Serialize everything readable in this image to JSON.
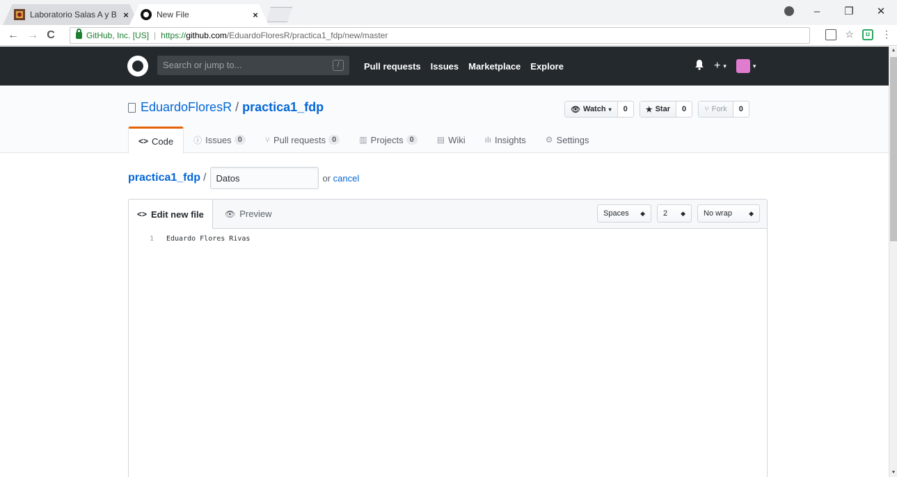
{
  "browser": {
    "tabs": [
      {
        "title": "Laboratorio Salas A y B",
        "close": "×"
      },
      {
        "title": "New File",
        "close": "×"
      }
    ],
    "window_controls": [
      "–",
      "❐",
      "✕"
    ],
    "nav": {
      "back": "←",
      "forward": "→",
      "reload": "C"
    },
    "address": {
      "secure_label": "GitHub, Inc. [US]",
      "url_proto": "https://",
      "url_host": "github.com",
      "url_path": "/EduardoFloresR/practica1_fdp/new/master"
    },
    "extensions": {
      "star": "☆",
      "pocket": "ʊ",
      "menu": "⋮"
    }
  },
  "gh_header": {
    "search_placeholder": "Search or jump to...",
    "search_key": "/",
    "nav": [
      "Pull requests",
      "Issues",
      "Marketplace",
      "Explore"
    ],
    "bell": "🔔",
    "plus": "+",
    "caret": "▾"
  },
  "repo": {
    "owner": "EduardoFloresR",
    "slash": "/",
    "name": "practica1_fdp",
    "watch_label": "Watch",
    "watch_count": "0",
    "star_label": "Star",
    "star_count": "0",
    "fork_label": "Fork",
    "fork_count": "0",
    "tabs": [
      {
        "label": "Code",
        "icon": "<>"
      },
      {
        "label": "Issues",
        "icon": "ⓘ",
        "count": "0"
      },
      {
        "label": "Pull requests",
        "icon": "⑂",
        "count": "0"
      },
      {
        "label": "Projects",
        "icon": "▥",
        "count": "0"
      },
      {
        "label": "Wiki",
        "icon": "▤"
      },
      {
        "label": "Insights",
        "icon": "ılı"
      },
      {
        "label": "Settings",
        "icon": "⚙"
      }
    ]
  },
  "file": {
    "repo_link": "practica1_fdp",
    "slash": "/",
    "filename_value": "Datos",
    "or_text": "or ",
    "cancel": "cancel"
  },
  "editor": {
    "tab_edit": "Edit new file",
    "tab_preview": "Preview",
    "indent_mode": "Spaces",
    "indent_size": "2",
    "wrap_mode": "No wrap",
    "lines": [
      {
        "num": "1",
        "text": "Eduardo Flores Rivas"
      }
    ]
  },
  "colors": {
    "header_bg": "#24292e",
    "link": "#0366d6",
    "tab_accent": "#e36209",
    "secure_green": "#1b7e30"
  }
}
